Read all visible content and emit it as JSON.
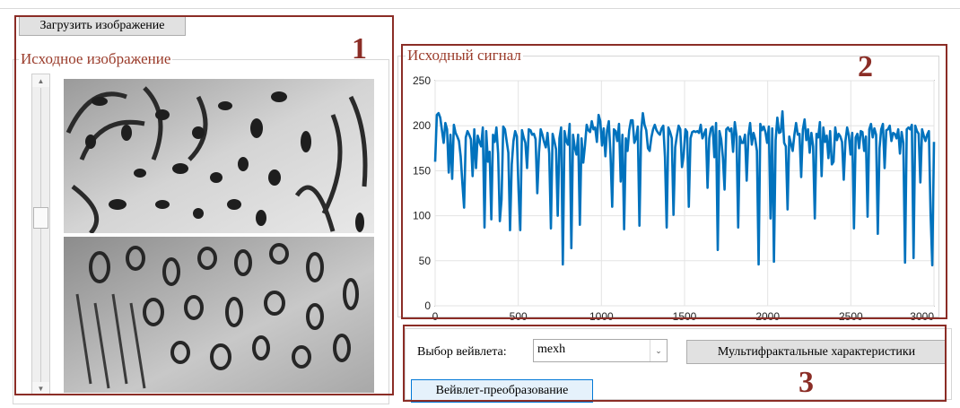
{
  "toolbar": {
    "load_image_label": "Загрузить изображение"
  },
  "panel_image": {
    "title": "Исходное изображение",
    "number": "1"
  },
  "panel_signal": {
    "title": "Исходный сигнал",
    "number": "2"
  },
  "panel_controls": {
    "number": "3",
    "wavelet_label": "Выбор вейвлета:",
    "wavelet_value": "mexh",
    "multifractal_button": "Мультифрактальные характеристики",
    "transform_button": "Вейвлет-преобразование"
  },
  "scrollbar": {
    "up_glyph": "▲",
    "down_glyph": "▼",
    "position_fraction": 0.44
  },
  "colors": {
    "accent": "#8b2d26",
    "line": "#0072bd",
    "legend": "#9a3b2a"
  },
  "chart_data": {
    "type": "line",
    "title": "Исходный сигнал",
    "xlim": [
      0,
      3000
    ],
    "ylim": [
      0,
      250
    ],
    "x_ticks": [
      0,
      500,
      1000,
      1500,
      2000,
      2500,
      3000
    ],
    "y_ticks": [
      0,
      50,
      100,
      150,
      200,
      250
    ],
    "grid": true,
    "series": [
      {
        "values": [
          160,
          212,
          214,
          209,
          195,
          181,
          203,
          196,
          148,
          190,
          141,
          201,
          192,
          188,
          183,
          166,
          136,
          109,
          187,
          194,
          190,
          185,
          144,
          196,
          153,
          189,
          182,
          177,
          198,
          87,
          194,
          160,
          171,
          96,
          190,
          182,
          198,
          169,
          94,
          118,
          199,
          196,
          183,
          170,
          84,
          157,
          183,
          194,
          188,
          128,
          84,
          195,
          187,
          181,
          153,
          196,
          195,
          190,
          191,
          185,
          125,
          170,
          196,
          190,
          182,
          176,
          192,
          169,
          86,
          191,
          183,
          174,
          100,
          186,
          198,
          46,
          194,
          183,
          179,
          202,
          64,
          190,
          176,
          168,
          190,
          90,
          186,
          159,
          178,
          201,
          195,
          193,
          205,
          196,
          198,
          182,
          212,
          205,
          178,
          197,
          166,
          195,
          205,
          168,
          110,
          196,
          194,
          183,
          202,
          138,
          190,
          85,
          186,
          172,
          195,
          206,
          206,
          181,
          186,
          199,
          89,
          193,
          214,
          201,
          195,
          175,
          172,
          187,
          196,
          201,
          195,
          192,
          190,
          197,
          200,
          165,
          87,
          198,
          193,
          186,
          101,
          176,
          189,
          200,
          196,
          154,
          168,
          196,
          193,
          110,
          186,
          193,
          194,
          193,
          194,
          192,
          201,
          186,
          191,
          196,
          131,
          186,
          197,
          199,
          165,
          203,
          62,
          194,
          185,
          165,
          129,
          196,
          198,
          194,
          197,
          171,
          204,
          189,
          87,
          188,
          181,
          181,
          190,
          139,
          189,
          203,
          179,
          192,
          185,
          172,
          46,
          202,
          195,
          199,
          193,
          181,
          199,
          97,
          197,
          49,
          184,
          209,
          192,
          193,
          216,
          181,
          177,
          107,
          188,
          180,
          172,
          190,
          203,
          190,
          191,
          143,
          196,
          207,
          184,
          196,
          170,
          192,
          177,
          97,
          191,
          187,
          204,
          144,
          198,
          182,
          189,
          164,
          194,
          157,
          160,
          198,
          184,
          191,
          188,
          182,
          140,
          183,
          198,
          189,
          168,
          192,
          86,
          187,
          191,
          175,
          194,
          193,
          172,
          188,
          99,
          196,
          202,
          187,
          197,
          190,
          80,
          175,
          196,
          202,
          153,
          195,
          196,
          200,
          183,
          192,
          191,
          186,
          196,
          169,
          193,
          181,
          48,
          196,
          198,
          196,
          201,
          53,
          200,
          194,
          191,
          137,
          196,
          189,
          183,
          190,
          194,
          103,
          45,
          182
        ]
      }
    ]
  }
}
